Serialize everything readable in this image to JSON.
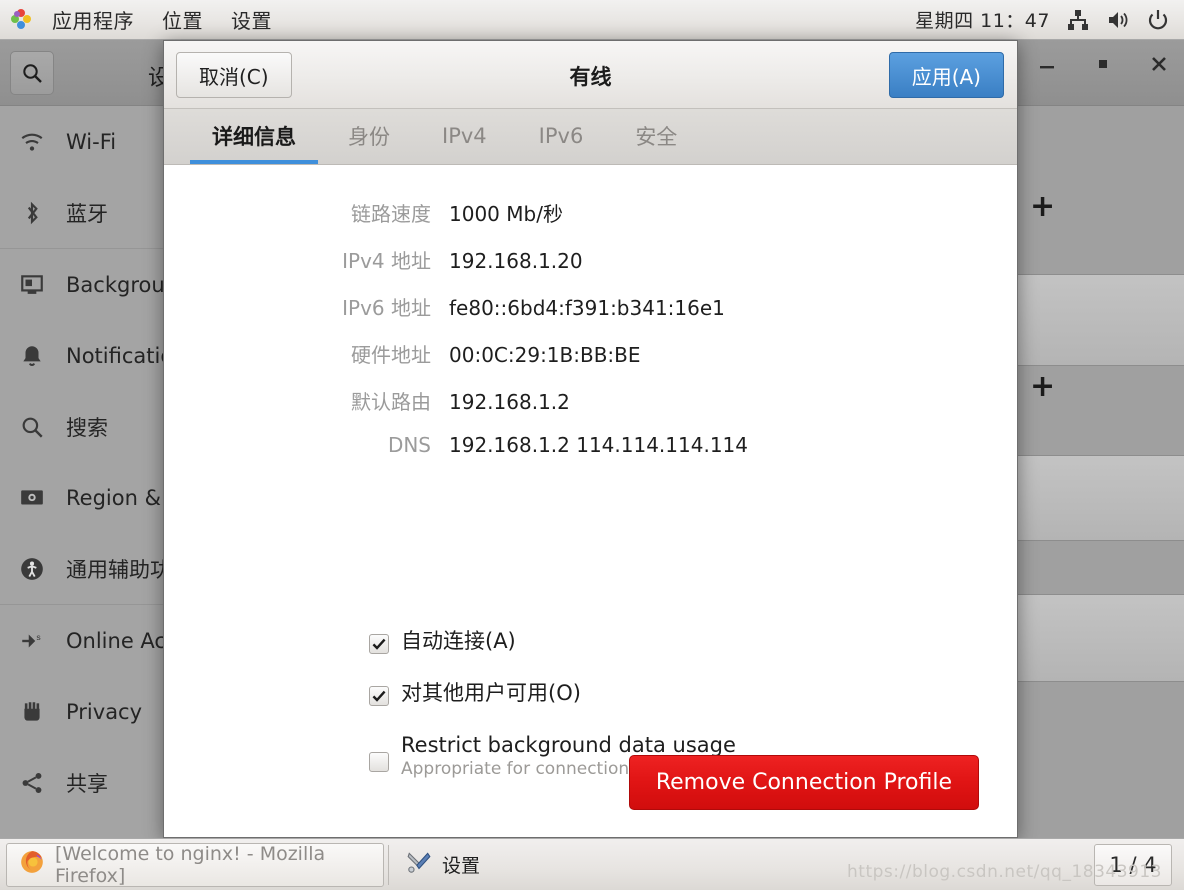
{
  "panel": {
    "menus": [
      "应用程序",
      "位置",
      "设置"
    ],
    "clock": "星期四 11：47",
    "icons": [
      "network-icon",
      "volume-icon",
      "power-icon"
    ]
  },
  "settings_window": {
    "title_fragment": "设",
    "search_icon": "search-icon",
    "window_controls": [
      "minimize",
      "maximize",
      "close"
    ],
    "sidebar": [
      {
        "icon": "wifi-icon",
        "label": "Wi-Fi"
      },
      {
        "icon": "bluetooth-icon",
        "label": "蓝牙"
      },
      {
        "icon": "background-icon",
        "label": "Background"
      },
      {
        "icon": "notifications-icon",
        "label": "Notifications"
      },
      {
        "icon": "search-icon",
        "label": "搜索"
      },
      {
        "icon": "region-icon",
        "label": "Region & Language"
      },
      {
        "icon": "accessibility-icon",
        "label": "通用辅助功能"
      },
      {
        "icon": "online-accounts-icon",
        "label": "Online Accounts"
      },
      {
        "icon": "privacy-icon",
        "label": "Privacy"
      },
      {
        "icon": "sharing-icon",
        "label": "共享"
      }
    ],
    "add_buttons": [
      "+",
      "+"
    ]
  },
  "dialog": {
    "cancel_label": "取消(C)",
    "title": "有线",
    "apply_label": "应用(A)",
    "tabs": [
      {
        "label": "详细信息",
        "active": true
      },
      {
        "label": "身份",
        "active": false
      },
      {
        "label": "IPv4",
        "active": false
      },
      {
        "label": "IPv6",
        "active": false
      },
      {
        "label": "安全",
        "active": false
      }
    ],
    "details": [
      {
        "label": "链路速度",
        "value": "1000 Mb/秒"
      },
      {
        "label": "IPv4 地址",
        "value": "192.168.1.20"
      },
      {
        "label": "IPv6 地址",
        "value": "fe80::6bd4:f391:b341:16e1"
      },
      {
        "label": "硬件地址",
        "value": "00:0C:29:1B:BB:BE"
      },
      {
        "label": "默认路由",
        "value": "192.168.1.2"
      },
      {
        "label": "DNS",
        "value": "192.168.1.2 114.114.114.114"
      }
    ],
    "checkboxes": [
      {
        "label": "自动连接(A)",
        "checked": true,
        "sub": ""
      },
      {
        "label": "对其他用户可用(O)",
        "checked": true,
        "sub": ""
      },
      {
        "label": "Restrict background data usage",
        "checked": false,
        "sub": "Appropriate for connections that have data charges or limits."
      }
    ],
    "remove_label": "Remove Connection Profile",
    "accent_color": "#3f8fdb",
    "danger_color": "#e01414"
  },
  "taskbar": {
    "items": [
      {
        "icon": "firefox-icon",
        "label": "[Welcome to nginx! - Mozilla Firefox]"
      },
      {
        "icon": "tools-icon",
        "label": "设置"
      }
    ],
    "workspace": "1 / 4"
  },
  "watermark": "https://blog.csdn.net/qq_18343913"
}
